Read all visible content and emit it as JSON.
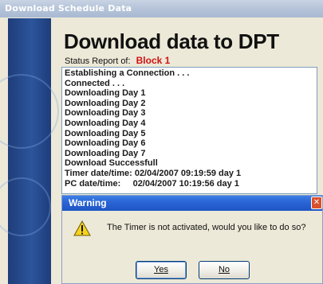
{
  "window": {
    "title": "Download Schedule Data"
  },
  "main": {
    "heading": "Download data to DPT",
    "status_label": "Status Report of:",
    "status_value": "Block 1"
  },
  "log": {
    "lines": [
      "Establishing a Connection . . .",
      "Connected . . .",
      "Downloading Day 1",
      "Downloading Day 2",
      "Downloading Day 3",
      "Downloading Day 4",
      "Downloading Day 5",
      "Downloading Day 6",
      "Downloading Day 7",
      "Download Successfull",
      "Timer date/time: 02/04/2007 09:19:59 day 1",
      "PC date/time:     02/04/2007 10:19:56 day 1"
    ]
  },
  "dialog": {
    "title": "Warning",
    "close_glyph": "✕",
    "message": "The Timer is not activated, would you like to do so?",
    "icon": "warning-icon",
    "yes_label": "Yes",
    "no_label": "No"
  },
  "colors": {
    "status_value": "#d01010",
    "dialog_title": "#2a64d5",
    "side_panel": "#2c559c"
  }
}
